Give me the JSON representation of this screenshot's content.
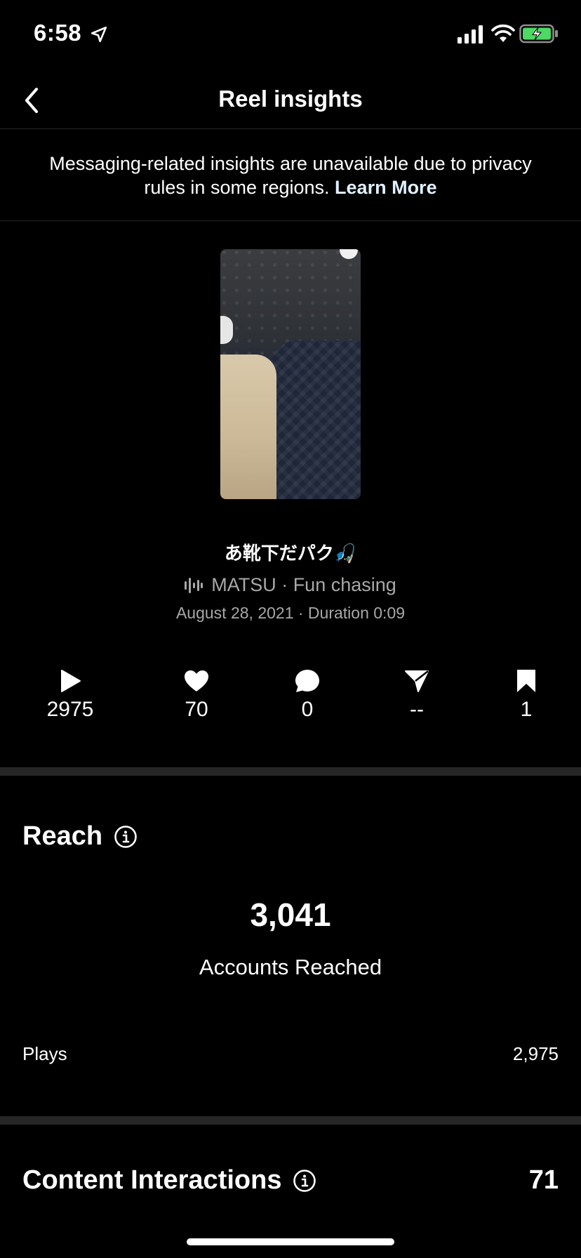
{
  "status_bar": {
    "time": "6:58"
  },
  "nav": {
    "title": "Reel insights"
  },
  "notice": {
    "text": "Messaging-related insights are unavailable due to privacy rules in some regions.",
    "link": "Learn More"
  },
  "reel": {
    "caption": "あ靴下だパク🎣",
    "audio": "MATSU · Fun chasing",
    "meta": "August 28, 2021 · Duration 0:09"
  },
  "stats": {
    "plays": "2975",
    "likes": "70",
    "comments": "0",
    "shares": "--",
    "saves": "1"
  },
  "reach": {
    "title": "Reach",
    "accounts_reached": "3,041",
    "accounts_reached_label": "Accounts Reached",
    "plays_label": "Plays",
    "plays_value": "2,975"
  },
  "content_interactions": {
    "title": "Content Interactions",
    "value": "71"
  }
}
